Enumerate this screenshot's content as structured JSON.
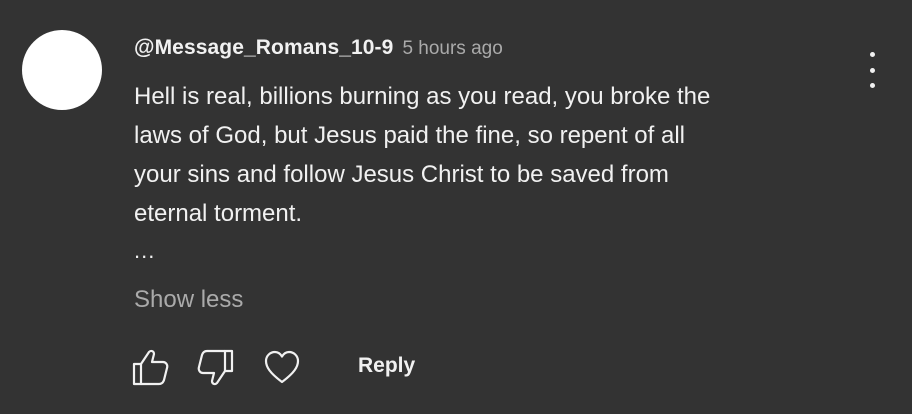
{
  "comment": {
    "author": "@Message_Romans_10-9",
    "timestamp": "5 hours ago",
    "lines": [
      "Hell is real, billions burning as you read, you broke the",
      "laws of God, but Jesus paid the fine, so repent of all",
      "your sins and follow Jesus Christ to be saved from",
      "eternal torment."
    ],
    "ellipsis": "...",
    "toggle_label": "Show less",
    "reply_label": "Reply",
    "avatar_color": "#ffffff"
  },
  "icons": {
    "like": "thumbs-up-icon",
    "dislike": "thumbs-down-icon",
    "heart": "heart-icon",
    "menu": "more-vertical-icon"
  },
  "colors": {
    "background": "#333333",
    "text_primary": "#f1f1f1",
    "text_secondary": "#aaaaaa"
  }
}
